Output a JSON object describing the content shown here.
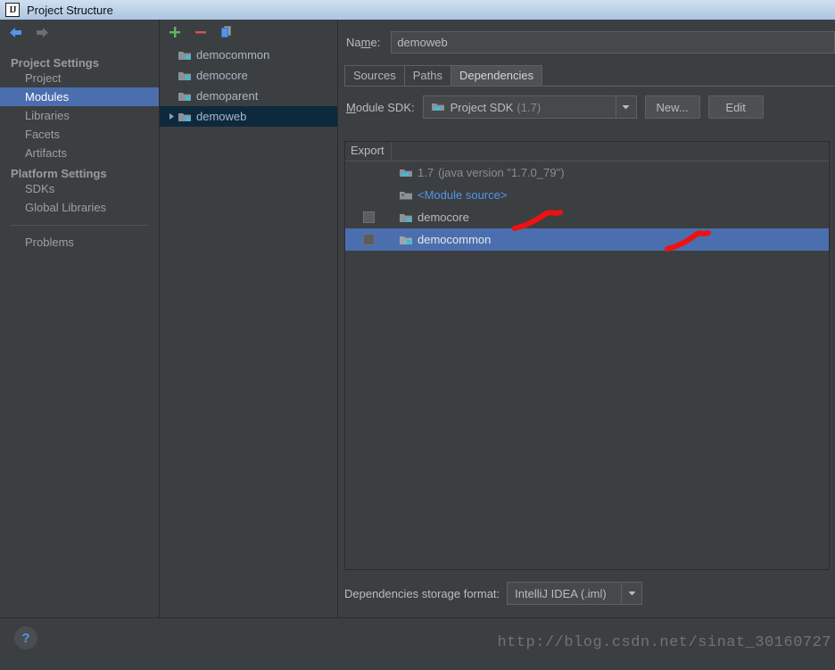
{
  "window": {
    "title": "Project Structure",
    "app_icon": "intellij-idea-icon"
  },
  "nav": {
    "back_icon": "arrow-left-icon",
    "forward_icon": "arrow-right-icon"
  },
  "sidebar": {
    "groups": [
      {
        "label": "Project Settings",
        "items": [
          {
            "label": "Project",
            "selected": false
          },
          {
            "label": "Modules",
            "selected": true
          },
          {
            "label": "Libraries",
            "selected": false
          },
          {
            "label": "Facets",
            "selected": false
          },
          {
            "label": "Artifacts",
            "selected": false
          }
        ]
      },
      {
        "label": "Platform Settings",
        "items": [
          {
            "label": "SDKs",
            "selected": false
          },
          {
            "label": "Global Libraries",
            "selected": false
          }
        ]
      }
    ],
    "problems": {
      "label": "Problems",
      "selected": false
    }
  },
  "modules_panel": {
    "toolbar": [
      {
        "name": "add-module-button",
        "icon": "plus-icon",
        "color": "#5fb85f"
      },
      {
        "name": "remove-module-button",
        "icon": "minus-icon",
        "color": "#d9534f"
      },
      {
        "name": "copy-module-button",
        "icon": "copy-icon",
        "color": "#5394ec"
      }
    ],
    "modules": [
      {
        "label": "democommon",
        "selected": false,
        "expandable": false
      },
      {
        "label": "democore",
        "selected": false,
        "expandable": false
      },
      {
        "label": "demoparent",
        "selected": false,
        "expandable": false
      },
      {
        "label": "demoweb",
        "selected": true,
        "expandable": true
      }
    ]
  },
  "detail": {
    "name_label": "Name:",
    "name_label_mnemonic": "m",
    "name_value": "demoweb",
    "name_placeholder": "",
    "tabs": [
      {
        "label": "Sources",
        "active": false
      },
      {
        "label": "Paths",
        "active": false
      },
      {
        "label": "Dependencies",
        "active": true
      }
    ],
    "sdk_label": "Module SDK:",
    "sdk_label_mnemonic": "M",
    "sdk_value": "Project SDK",
    "sdk_value_suffix": "(1.7)",
    "sdk_icon": "sdk-folder-icon",
    "new_button": "New...",
    "edit_button": "Edit",
    "table": {
      "columns": [
        "Export",
        ""
      ],
      "rows": [
        {
          "export_checkbox": null,
          "icon": "sdk-folder-icon",
          "name": "1.7",
          "detail": "(java version \"1.7.0_79\")",
          "style": "muted",
          "selected": false
        },
        {
          "export_checkbox": null,
          "icon": "module-source-icon",
          "name": "<Module source>",
          "detail": "",
          "style": "link",
          "selected": false
        },
        {
          "export_checkbox": false,
          "icon": "module-icon",
          "name": "democore",
          "detail": "",
          "style": "plain",
          "selected": false
        },
        {
          "export_checkbox": false,
          "icon": "module-icon",
          "name": "democommon",
          "detail": "",
          "style": "plain",
          "selected": true
        }
      ]
    },
    "storage_label": "Dependencies storage format:",
    "storage_value": "IntelliJ IDEA (.iml)"
  },
  "bottom": {
    "help_icon": "question-mark-icon",
    "watermark": "http://blog.csdn.net/sinat_30160727"
  },
  "annotations": {
    "stroke_color": "#ee1111",
    "marks": [
      {
        "name": "red-mark-democore"
      },
      {
        "name": "red-mark-democommon"
      }
    ]
  }
}
